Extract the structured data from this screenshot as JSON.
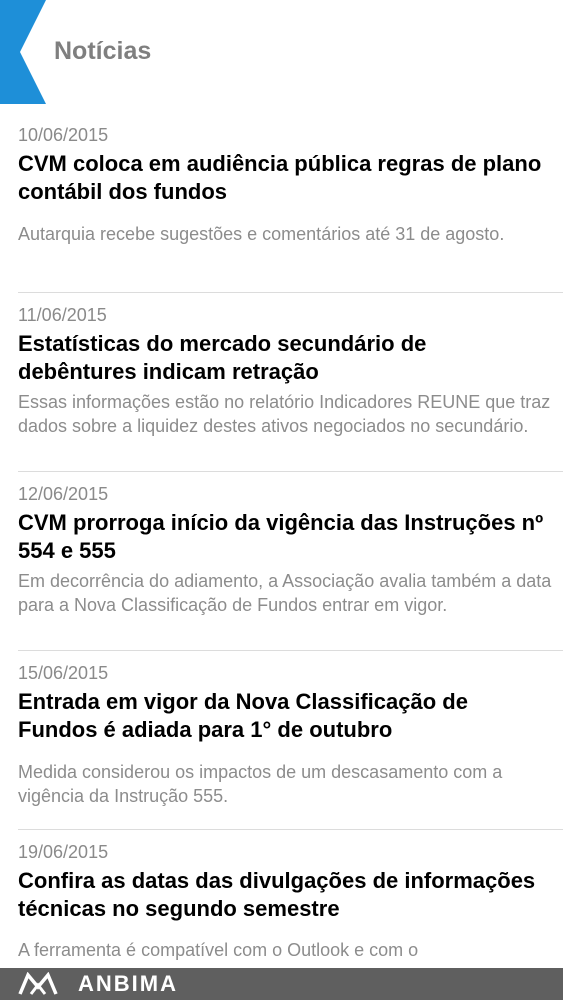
{
  "header": {
    "title": "Notícias",
    "accent_color": "#1e8fd8"
  },
  "news": [
    {
      "date": "10/06/2015",
      "headline": "CVM coloca em audiência pública regras de plano contábil dos fundos",
      "summary": "Autarquia recebe sugestões e comentários até 31 de agosto."
    },
    {
      "date": "11/06/2015",
      "headline": "Estatísticas do mercado secundário de debêntures indicam retração",
      "summary": "Essas informações estão no relatório Indicadores REUNE que traz dados sobre a liquidez destes ativos negociados no secundário."
    },
    {
      "date": "12/06/2015",
      "headline": "CVM prorroga início da vigência das Instruções nº 554 e 555",
      "summary": "Em decorrência do adiamento, a Associação avalia também a data para a Nova Classificação de Fundos entrar em vigor."
    },
    {
      "date": "15/06/2015",
      "headline": "Entrada em vigor da Nova Classificação de Fundos é adiada para 1° de outubro",
      "summary": "Medida considerou os impactos de um descasamento com a vigência da Instrução 555."
    },
    {
      "date": "19/06/2015",
      "headline": "Confira as datas das divulgações de informações técnicas no segundo semestre",
      "summary": "A ferramenta é compatível com o Outlook e com o"
    }
  ],
  "footer": {
    "brand": "ANBIMA",
    "background_color": "#5f5f5f"
  }
}
